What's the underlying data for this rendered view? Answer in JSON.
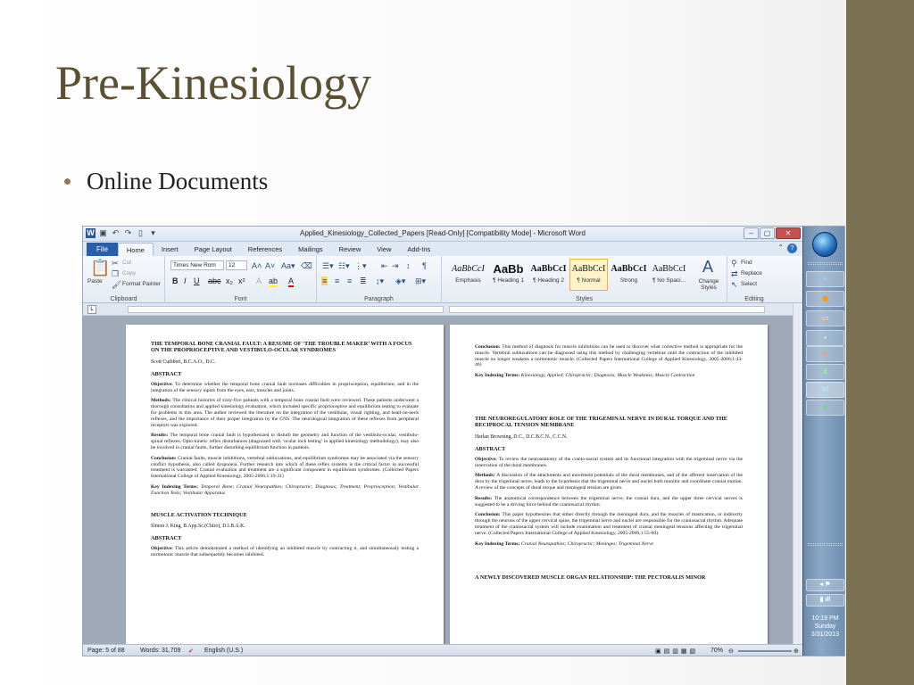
{
  "slide": {
    "title": "Pre-Kinesiology",
    "bullets": [
      "Online Documents"
    ]
  },
  "word": {
    "window_title": "Applied_Kinesiology_Collected_Papers [Read-Only] [Compatibility Mode] - Microsoft Word",
    "menu": {
      "file": "File",
      "tabs": [
        "Home",
        "Insert",
        "Page Layout",
        "References",
        "Mailings",
        "Review",
        "View",
        "Add-Ins"
      ]
    },
    "ribbon": {
      "clipboard": {
        "paste": "Paste",
        "cut": "Cut",
        "copy": "Copy",
        "format_painter": "Format Painter",
        "label": "Clipboard"
      },
      "font": {
        "name": "Times New Rom",
        "size": "12",
        "label": "Font"
      },
      "paragraph": {
        "label": "Paragraph"
      },
      "styles": {
        "items": [
          {
            "sample": "AaBbCcI",
            "name": "Emphasis"
          },
          {
            "sample": "AaBb",
            "name": "¶ Heading 1"
          },
          {
            "sample": "AaBbCcI",
            "name": "¶ Heading 2"
          },
          {
            "sample": "AaBbCcI",
            "name": "¶ Normal"
          },
          {
            "sample": "AaBbCcI",
            "name": "Strong"
          },
          {
            "sample": "AaBbCcI",
            "name": "¶ No Spaci..."
          }
        ],
        "change_styles": "Change Styles",
        "label": "Styles"
      },
      "editing": {
        "find": "Find",
        "replace": "Replace",
        "select": "Select",
        "label": "Editing"
      }
    },
    "left_page": {
      "title": "THE TEMPORAL BONE CRANIAL FAULT: A RESUME OF ‘THE TROUBLE MAKER’ WITH A FOCUS ON THE PROPRIOCEPTIVE AND VESTIBULO-OCULAR SYNDROMES",
      "author": "Scott Cuthbert, B.C.A.O., D.C.",
      "abstract": "ABSTRACT",
      "objective_label": "Objective:",
      "objective": "To determine whether the temporal bone cranial fault increases difficulties in proprioception, equilibrium, and in the integration of the sensory inputs from the eyes, ears, muscles and joints.",
      "methods_label": "Methods:",
      "methods": "The clinical histories of sixty-five patients with a temporal bone cranial fault were reviewed. These patients underwent a thorough consultation and applied kinesiology evaluation, which included specific proprioceptive and equilibrium testing to evaluate for problems in this area. The author reviewed the literature on the integration of the vestibular, visual righting, and head-on-neck reflexes, and the importance of their proper integration by the CNS. The neurological integration of these reflexes from peripheral receptors was explored.",
      "results_label": "Results:",
      "results": "The temporal bone cranial fault is hypothesized to disturb the geometry and function of the vestibulo-ocular, vestibulo-spinal reflexes. Opto-kinetic reflex disturbances (diagnosed with ‘ocular lock testing’ in applied kinesiology methodology), may also be involved in cranial faults, further disturbing equilibrium function in patients.",
      "conclusion_label": "Conclusion:",
      "conclusion": "Cranial faults, muscle inhibitions, vertebral subluxations, and equilibrium syndromes may be associated via the sensory conflict hypothesis, also called dyspnoeia. Further research into which of these reflex systems is the critical factor in successful treatment is warranted. Cranial evaluation and treatment are a significant component in equilibrium syndromes. (Collected Papers International College of Applied Kinesiology, 2005-2006;1:19-31)",
      "key_label": "Key Indexing Terms:",
      "key_terms": "Temporal Bone; Cranial Neuropathies; Chiropractic; Diagnosis; Treatment; Proprioception; Vestibular Function Tests; Vestibular Apparatus",
      "title2": "MUSCLE ACTIVATION TECHNIQUE",
      "author2": "Simon J. King, B.App.Sc.(Chiro), D.I.B.A.K.",
      "abstract2": "ABSTRACT",
      "objective2_label": "Objective:",
      "objective2": "This article demonstrated a method of identifying an inhibited muscle by contracting it, and simultaneously testing a normotonic muscle that subsequently becomes inhibited."
    },
    "right_page": {
      "conclusion_label": "Conclusion:",
      "conclusion": "This method of diagnosis for muscle inhibitions can be used to discover what corrective method is appropriate for the muscle. Vertebral subluxations can be diagnosed using this method by challenging vertebrae until the contraction of the inhibited muscle no longer weakens a normotonic muscle. (Collected Papers International College of Applied Kinesiology, 2005-2006;1:43-46)",
      "key_label": "Key Indexing Terms:",
      "key_terms": "Kinesiology, Applied; Chiropractic; Diagnosis; Muscle Weakness; Muscle Contraction",
      "title": "THE NEUROREGULATORY ROLE OF THE TRIGEMINAL NERVE IN DURAL TORQUE AND THE RECIPROCAL TENSION MEMBRANE",
      "author": "Harlan Browning, D.C., D.C.B.C.N., C.C.N.",
      "abstract": "ABSTRACT",
      "objective_label": "Objective:",
      "objective": "To review the neuroanatomy of the cranio-sacral system and its functional integration with the trigeminal nerve via the innervation of the dural membranes.",
      "methods_label": "Methods:",
      "methods": "A discussion of the attachments and movement potentials of the dural membranes, and of the afferent innervation of the dura by the trigeminal nerve, leads to the hypothesis that the trigeminal nerve and nuclei both monitor and coordinate cranial motion. A review of the concepts of dural torque and meningeal tension are given.",
      "results_label": "Results:",
      "results": "The anatomical correspondence between the trigeminal nerve, the cranial dura, and the upper three cervical nerves is suggested to be a driving force behind the craniosacral rhythm.",
      "conclusion2_label": "Conclusion:",
      "conclusion2": "This paper hypothesizes that either directly through the meningeal dura, and the muscles of mastication, or indirectly through the neurons of the upper cervical spine, the trigeminal nerve and nuclei are responsible for the craniosacral rhythm. Adequate treatment of the craniosacral system will include examination and treatment of cranial meningeal tensions affecting the trigeminal nerve. (Collected Papers International College of Applied Kinesiology, 2005-2006;1:55-60)",
      "key2_label": "Key Indexing Terms:",
      "key2_terms": "Cranial Neuropathies; Chiropractic; Meninges; Trigeminal Nerve",
      "cut_title": "A NEWLY DISCOVERED MUSCLE ORGAN RELATIONSHIP: THE PECTORALIS MINOR"
    },
    "status": {
      "page": "Page: 5 of 88",
      "words": "Words: 31,709",
      "language": "English (U.S.)",
      "zoom": "70%"
    }
  },
  "taskbar": {
    "items": [
      "P",
      "X",
      "W"
    ],
    "time": "10:19 PM",
    "day": "Sunday",
    "date": "3/31/2013"
  }
}
